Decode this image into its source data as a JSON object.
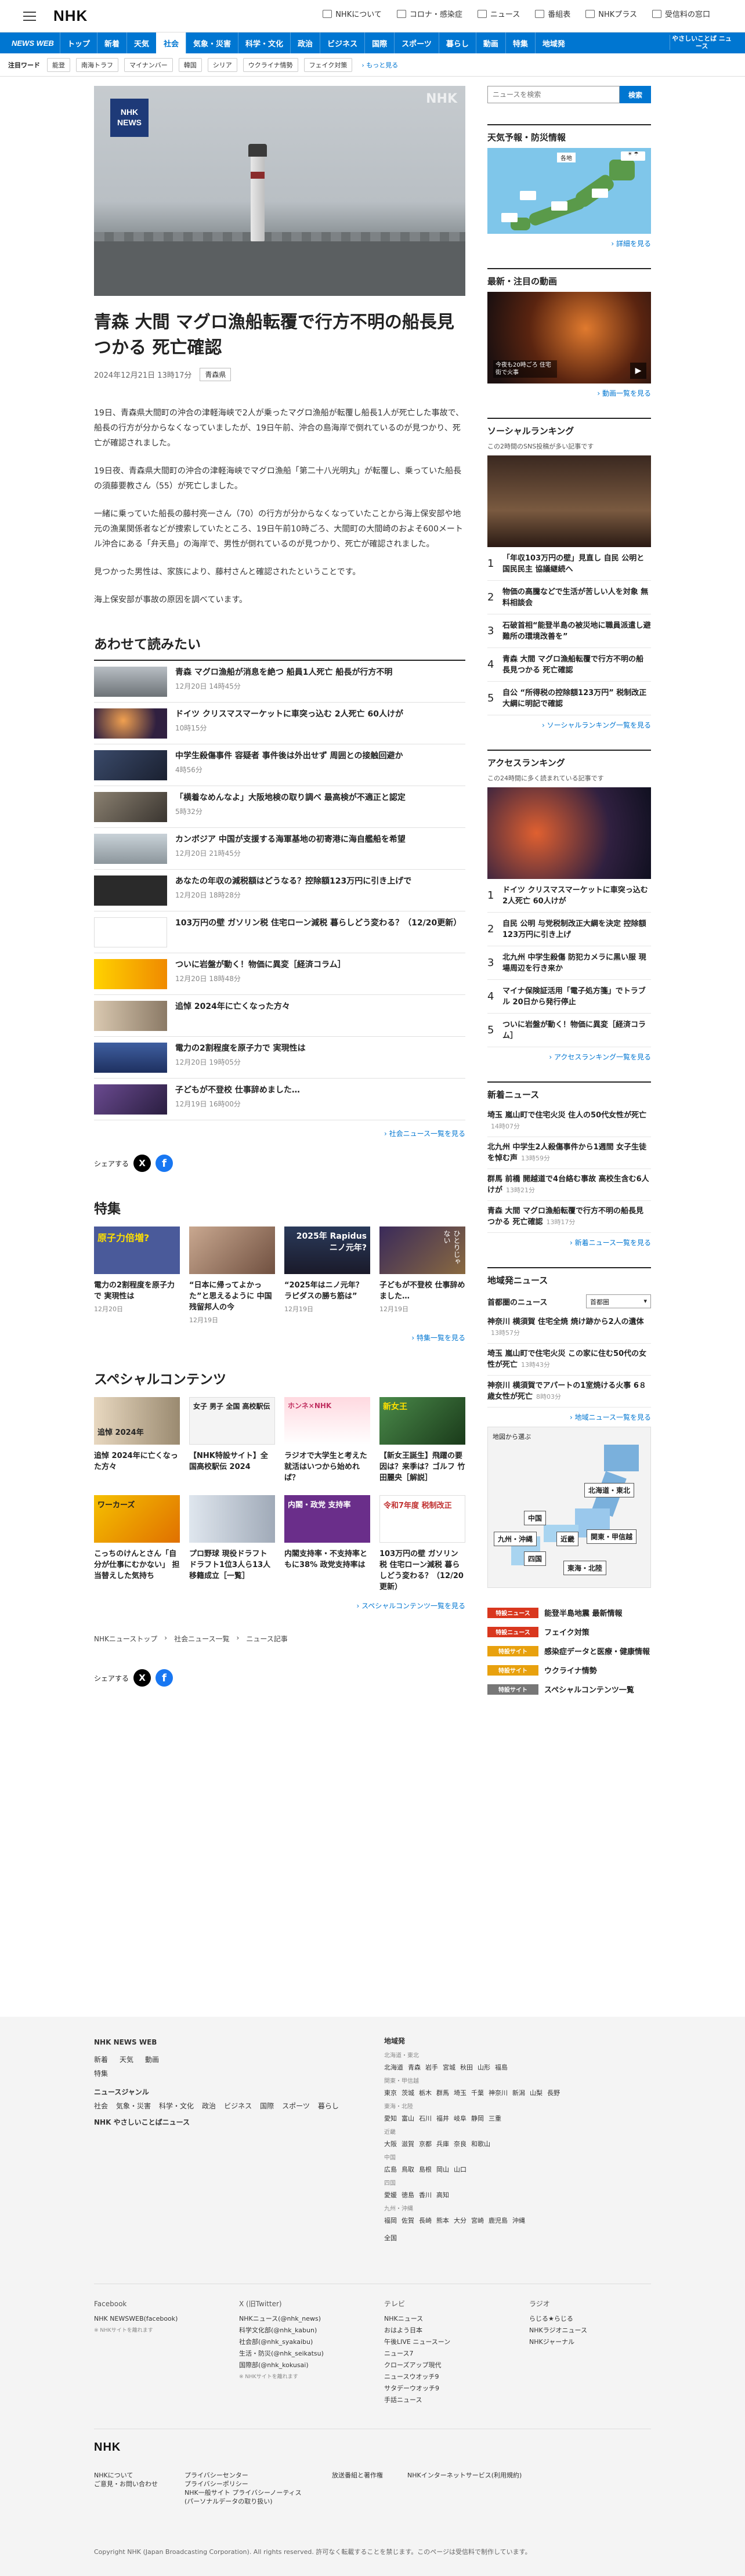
{
  "header": {
    "logo": "NHK",
    "links": [
      "NHKについて",
      "コロナ・感染症",
      "ニュース",
      "番組表",
      "NHKプラス",
      "受信料の窓口"
    ]
  },
  "nav": {
    "brand": "NEWS WEB",
    "items": [
      "トップ",
      "新着",
      "天気",
      "社会",
      "気象・災害",
      "科学・文化",
      "政治",
      "ビジネス",
      "国際",
      "スポーツ",
      "暮らし",
      "動画",
      "特集",
      "地域発"
    ],
    "active_index": 3,
    "yasashii": "やさしいことば ニュース"
  },
  "keywords": {
    "label": "注目ワード",
    "tags": [
      "能登",
      "南海トラフ",
      "マイナンバー",
      "韓国",
      "シリア",
      "ウクライナ情勢",
      "フェイク対策"
    ],
    "more": "もっと見る"
  },
  "article": {
    "image_watermark": "NHK",
    "badge": "NHK NEWS",
    "title": "青森 大間 マグロ漁船転覆で行方不明の船長見つかる 死亡確認",
    "date": "2024年12月21日 13時17分",
    "category": "青森県",
    "paragraphs": [
      "19日、青森県大間町の沖合の津軽海峡で2人が乗ったマグロ漁船が転覆し船長1人が死亡した事故で、船長の行方が分からなくなっていましたが、19日午前、沖合の島海岸で倒れているのが見つかり、死亡が確認されました。",
      "19日夜、青森県大間町の沖合の津軽海峡でマグロ漁船「第二十八光明丸」が転覆し、乗っていた船長の須藤要教さん（55）が死亡しました。",
      "一緒に乗っていた船長の藤村亮一さん（70）の行方が分からなくなっていたことから海上保安部や地元の漁業関係者などが捜索していたところ、19日午前10時ごろ、大間町の大間崎のおよそ600メートル沖合にある「弁天島」の海岸で、男性が倒れているのが見つかり、死亡が確認されました。",
      "見つかった男性は、家族により、藤村さんと確認されたということです。",
      "海上保安部が事故の原因を調べています。"
    ]
  },
  "related": {
    "heading": "あわせて読みたい",
    "items": [
      {
        "title": "青森 マグロ漁船が消息を絶つ 船員1人死亡 船長が行方不明",
        "date": "12月20日 14時45分"
      },
      {
        "title": "ドイツ クリスマスマーケットに車突っ込む 2人死亡 60人けが",
        "date": "10時15分"
      },
      {
        "title": "中学生殺傷事件 容疑者 事件後は外出せず 周囲との接触回避か",
        "date": "4時56分"
      },
      {
        "title": "「横着なめんなよ」大阪地検の取り調べ 最高検が不適正と認定",
        "date": "5時32分"
      },
      {
        "title": "カンボジア 中国が支援する海軍基地の初寄港に海自艦船を希望",
        "date": "12月20日 21時45分"
      },
      {
        "title": "あなたの年収の減税額はどうなる？控除額123万円に引き上げで",
        "date": "12月20日 18時28分"
      },
      {
        "title": "103万円の壁 ガソリン税 住宅ローン減税 暮らしどう変わる？（12/20更新）",
        "date": ""
      },
      {
        "title": "ついに岩盤が動く！物価に異変［経済コラム］",
        "date": "12月20日 18時48分"
      },
      {
        "title": "追悼 2024年に亡くなった方々",
        "date": ""
      },
      {
        "title": "電力の2割程度を原子力で 実現性は",
        "date": "12月20日 19時05分"
      },
      {
        "title": "子どもが不登校 仕事辞めました…",
        "date": "12月19日 16時00分"
      }
    ],
    "more": "社会ニュース一覧を見る"
  },
  "share": {
    "label": "シェアする",
    "x": "X",
    "fb": "f"
  },
  "features": {
    "heading": "特集",
    "items": [
      {
        "title": "電力の2割程度を原子力で 実現性は",
        "date": "12月20日",
        "img_text": "原子力倍増?"
      },
      {
        "title": "“日本に帰ってよかった”と思えるように 中国残留邦人の今",
        "date": "12月19日",
        "img_text": ""
      },
      {
        "title": "“2025年はニノ元年？ ラピダスの勝ち筋は”",
        "date": "12月19日",
        "img_text": "2025年 Rapidus ニノ元年?"
      },
      {
        "title": "子どもが不登校 仕事辞めました…",
        "date": "12月19日",
        "img_text": "ひとりじゃない"
      }
    ],
    "more": "特集一覧を見る"
  },
  "specials": {
    "heading": "スペシャルコンテンツ",
    "items": [
      {
        "title": "追悼 2024年に亡くなった方々",
        "img_text": "追悼 2024年"
      },
      {
        "title": "【NHK特設サイト】全国高校駅伝 2024",
        "img_text": "女子 男子 全国 高校駅伝"
      },
      {
        "title": "ラジオで大学生と考えた 就活はいつから始めれば？",
        "img_text": "ホンネ×NHK"
      },
      {
        "title": "【新女王誕生】飛躍の要因は？来季は？ゴルフ 竹田麗央［解説］",
        "img_text": "新女王"
      },
      {
        "title": "こっちのけんとさん「自分が仕事にむかない」 担当替えした気持ち",
        "img_text": "ワーカーズ"
      },
      {
        "title": "プロ野球 現役ドラフト ドラフト1位3人ら13人移籍成立［一覧］",
        "img_text": ""
      },
      {
        "title": "内閣支持率・不支持率ともに38% 政党支持率は",
        "img_text": "内閣・政党 支持率"
      },
      {
        "title": "103万円の壁 ガソリン税 住宅ローン減税 暮らしどう変わる？（12/20更新）",
        "img_text": "令和7年度 税制改正"
      }
    ],
    "more": "スペシャルコンテンツ一覧を見る"
  },
  "breadcrumb": [
    "NHKニューストップ",
    "社会ニュース一覧",
    "ニュース記事"
  ],
  "sidebar": {
    "search_placeholder": "ニュースを検索",
    "search_button": "検索",
    "weather": {
      "heading": "天気予報・防災情報",
      "more": "詳細を見る",
      "map_label": "各地"
    },
    "video": {
      "heading": "最新・注目の動画",
      "caption": "今夜も20時ごろ 住宅街で火事",
      "more": "動画一覧を見る"
    },
    "social": {
      "heading": "ソーシャルランキング",
      "sub": "この2時間のSNS投稿が多い記事です",
      "items": [
        "「年収103万円の壁」見直し 自民 公明と国民民主 協議継続へ",
        "物価の高騰などで生活が苦しい人を対象 無料相談会",
        "石破首相“能登半島の被災地に職員派遣し避難所の環境改善を”",
        "青森 大間 マグロ漁船転覆で行方不明の船長見つかる 死亡確認",
        "自公 “所得税の控除額123万円” 税制改正大綱に明記で確認"
      ],
      "more": "ソーシャルランキング一覧を見る"
    },
    "access": {
      "heading": "アクセスランキング",
      "sub": "この24時間に多く読まれている記事です",
      "items": [
        "ドイツ クリスマスマーケットに車突っ込む 2人死亡 60人けが",
        "自民 公明 与党税制改正大綱を決定 控除額123万円に引き上げ",
        "北九州 中学生殺傷 防犯カメラに黒い服 現場周辺を行き来か",
        "マイナ保険証活用「電子処方箋」でトラブル 20日から発行停止",
        "ついに岩盤が動く！物価に異変［経済コラム］"
      ],
      "more": "アクセスランキング一覧を見る"
    },
    "latest": {
      "heading": "新着ニュース",
      "items": [
        {
          "title": "埼玉 嵐山町で住宅火災 住人の50代女性が死亡",
          "date": "14時07分"
        },
        {
          "title": "北九州 中学生2人殺傷事件から1週間 女子生徒を悼む声",
          "date": "13時59分"
        },
        {
          "title": "群馬 前橋 開越道で4台絡む事故 高校生含む6人けが",
          "date": "13時21分"
        },
        {
          "title": "青森 大間 マグロ漁船転覆で行方不明の船長見つかる 死亡確認",
          "date": "13時17分"
        }
      ],
      "more": "新着ニュース一覧を見る"
    },
    "regional": {
      "heading": "地域発ニュース",
      "region": "首都圏のニュース",
      "select": "首都圏",
      "items": [
        {
          "title": "神奈川 横須賀 住宅全焼 焼け跡から2人の遺体",
          "date": "13時57分"
        },
        {
          "title": "埼玉 嵐山町で住宅火災 この家に住む50代の女性が死亡",
          "date": "13時43分"
        },
        {
          "title": "神奈川 横須賀でアパートの1室焼ける火事 6８歳女性が死亡",
          "date": "8時03分"
        }
      ],
      "more": "地域ニュース一覧を見る",
      "map_heading": "地図から選ぶ",
      "areas": [
        "北海道・東北",
        "関東・甲信越",
        "東海・北陸",
        "近畿",
        "中国",
        "九州・沖縄",
        "四国"
      ]
    },
    "banners": [
      {
        "label": "特設ニュース",
        "title": "能登半島地震 最新情報",
        "color": "#d9371e"
      },
      {
        "label": "特設ニュース",
        "title": "フェイク対策",
        "color": "#d9371e"
      },
      {
        "label": "特設サイト",
        "title": "感染症データと医療・健康情報",
        "color": "#e8a10e"
      },
      {
        "label": "特設サイト",
        "title": "ウクライナ情勢",
        "color": "#e8a10e"
      },
      {
        "label": "特設サイト",
        "title": "スペシャルコンテンツ一覧",
        "color": "#777777"
      }
    ]
  },
  "footer": {
    "brand": "NHK NEWS WEB",
    "col1": [
      "新着",
      "天気",
      "動画"
    ],
    "col1b": "特集",
    "genre_head": "ニュースジャンル",
    "genres": [
      "社会",
      "気象・災害",
      "科学・文化",
      "政治",
      "ビジネス",
      "国際",
      "スポーツ",
      "暮らし"
    ],
    "yasashii": "NHK やさしいことばニュース",
    "region_head": "地域発",
    "regions": [
      {
        "group": "北海道・東北",
        "prefs": [
          "北海道",
          "青森",
          "岩手",
          "宮城",
          "秋田",
          "山形",
          "福島"
        ]
      },
      {
        "group": "関東・甲信越",
        "prefs": [
          "東京",
          "茨城",
          "栃木",
          "群馬",
          "埼玉",
          "千葉",
          "神奈川",
          "新潟",
          "山梨",
          "長野"
        ]
      },
      {
        "group": "東海・北陸",
        "prefs": [
          "愛知",
          "富山",
          "石川",
          "福井",
          "岐阜",
          "静岡",
          "三重"
        ]
      },
      {
        "group": "近畿",
        "prefs": [
          "大阪",
          "滋賀",
          "京都",
          "兵庫",
          "奈良",
          "和歌山"
        ]
      },
      {
        "group": "中国",
        "prefs": [
          "広島",
          "鳥取",
          "島根",
          "岡山",
          "山口"
        ]
      },
      {
        "group": "四国",
        "prefs": [
          "愛媛",
          "徳島",
          "香川",
          "高知"
        ]
      },
      {
        "group": "九州・沖縄",
        "prefs": [
          "福岡",
          "佐賀",
          "長崎",
          "熊本",
          "大分",
          "宮崎",
          "鹿児島",
          "沖縄"
        ]
      }
    ],
    "all": "全国",
    "social": {
      "facebook": {
        "head": "Facebook",
        "items": [
          "NHK NEWSWEB(facebook)"
        ],
        "note": "※ NHKサイトを離れます"
      },
      "x": {
        "head": "X (旧Twitter)",
        "items": [
          "NHKニュース(@nhk_news)",
          "科学文化部(@nhk_kabun)",
          "社会部(@nhk_syakaibu)",
          "生活・防災(@nhk_seikatsu)",
          "国際部(@nhk_kokusai)"
        ],
        "note": "※ NHKサイトを離れます"
      },
      "tv": {
        "head": "テレビ",
        "items": [
          "NHKニュース",
          "おはよう日本",
          "午後LIVE ニュースーン",
          "ニュース7",
          "クローズアップ現代",
          "ニュースウオッチ9",
          "サタデーウオッチ9",
          "手話ニュース"
        ]
      },
      "radio": {
        "head": "ラジオ",
        "items": [
          "らじる★らじる",
          "NHKラジオニュース",
          "NHKジャーナル"
        ]
      }
    },
    "bottom_logo": "NHK",
    "bottom_links": [
      "NHKについて",
      "ご意見・お問い合わせ",
      "プライバシーセンター",
      "プライバシーポリシー",
      "NHK一般サイト プライバシーノーティス (パーソナルデータの取り扱い)",
      "放送番組と著作権",
      "NHKインターネットサービス(利用規約)"
    ],
    "copyright": "Copyright NHK (Japan Broadcasting Corporation). All rights reserved. 許可なく転載することを禁じます。このページは受信料で制作しています。",
    "pagetop": "▲"
  }
}
